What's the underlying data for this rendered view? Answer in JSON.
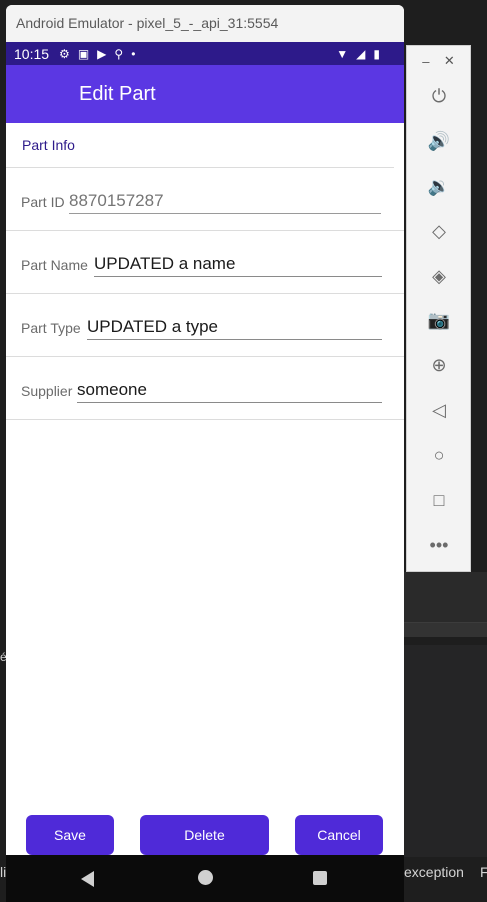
{
  "window": {
    "title": "Android Emulator - pixel_5_-_api_31:5554"
  },
  "status_bar": {
    "time": "10:15"
  },
  "app_bar": {
    "title": "Edit Part"
  },
  "form": {
    "section_title": "Part Info",
    "fields": [
      {
        "label": "Part ID",
        "value": "",
        "placeholder": "8870157287"
      },
      {
        "label": "Part Name",
        "value": "UPDATED a name"
      },
      {
        "label": "Part Type",
        "value": "UPDATED a type"
      },
      {
        "label": "Supplier",
        "value": "someone"
      }
    ]
  },
  "buttons": {
    "save": "Save",
    "delete": "Delete",
    "cancel": "Cancel"
  },
  "side_toolbar": {
    "minimize": "–",
    "close": "✕",
    "tools": [
      "power-icon",
      "volume-up-icon",
      "volume-down-icon",
      "rotate-left-icon",
      "rotate-right-icon",
      "camera-icon",
      "zoom-icon",
      "back-icon",
      "home-icon",
      "overview-icon",
      "more-icon"
    ]
  },
  "ide": {
    "exception_text": "exception",
    "right_char": "F",
    "left_char": "li",
    "left_char2": "é"
  },
  "colors": {
    "app_bar": "#5b37e3",
    "status_bar": "#2d1a8a",
    "button": "#4f2ad8",
    "section_title": "#2d1a8a"
  }
}
